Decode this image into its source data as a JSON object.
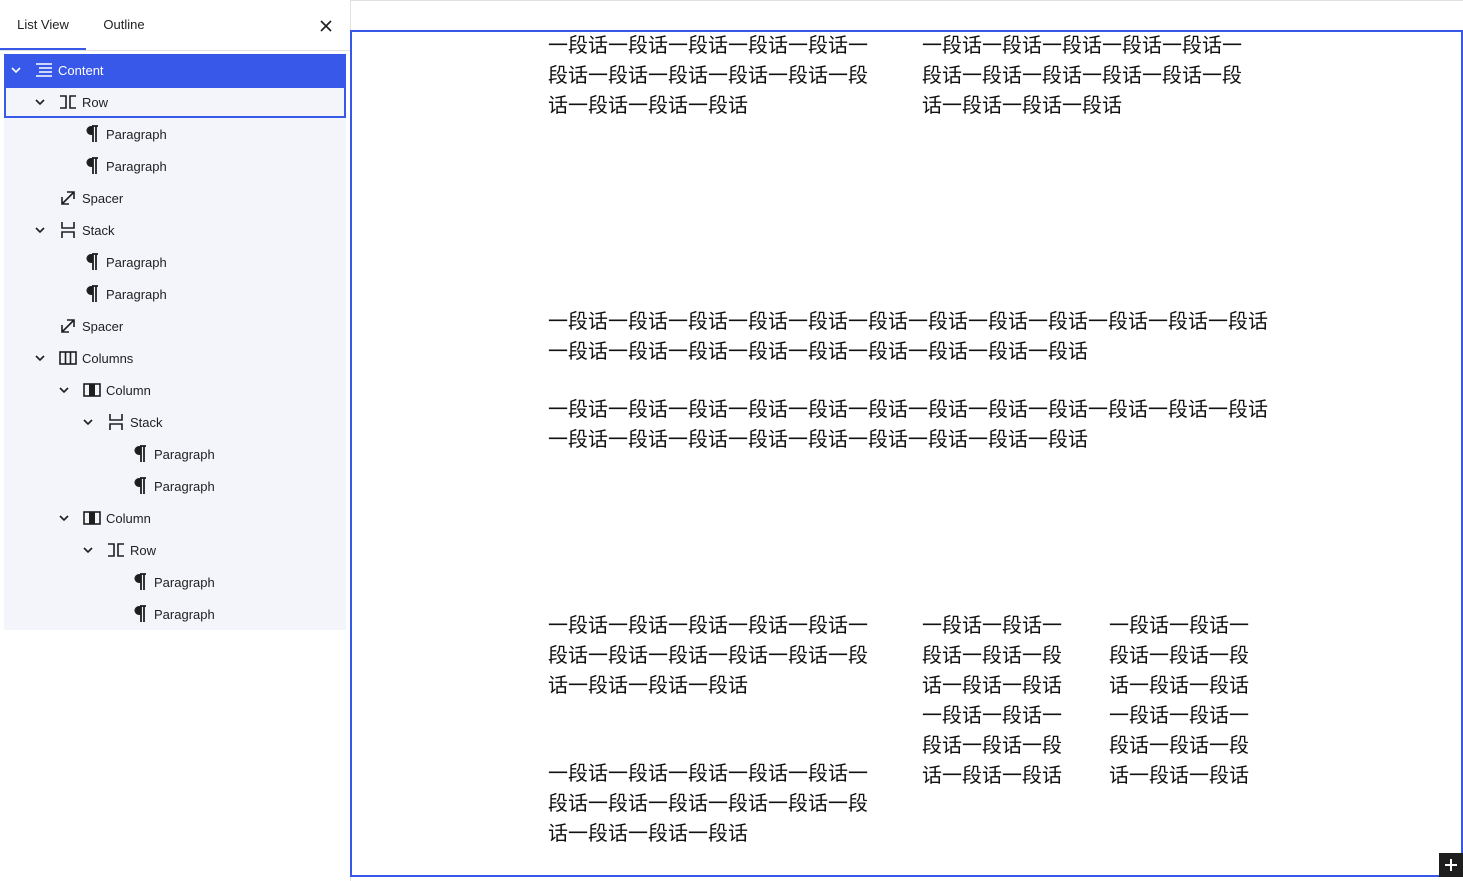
{
  "sidebar": {
    "tabs": [
      "List View",
      "Outline"
    ],
    "tree": [
      {
        "label": "Content",
        "icon": "content-icon",
        "chevron": true
      },
      {
        "label": "Row",
        "icon": "row-icon",
        "chevron": true
      },
      {
        "label": "Paragraph",
        "icon": "paragraph-icon",
        "chevron": false
      },
      {
        "label": "Paragraph",
        "icon": "paragraph-icon",
        "chevron": false
      },
      {
        "label": "Spacer",
        "icon": "spacer-icon",
        "chevron": false
      },
      {
        "label": "Stack",
        "icon": "stack-icon",
        "chevron": true
      },
      {
        "label": "Paragraph",
        "icon": "paragraph-icon",
        "chevron": false
      },
      {
        "label": "Paragraph",
        "icon": "paragraph-icon",
        "chevron": false
      },
      {
        "label": "Spacer",
        "icon": "spacer-icon",
        "chevron": false
      },
      {
        "label": "Columns",
        "icon": "columns-icon",
        "chevron": true
      },
      {
        "label": "Column",
        "icon": "column-icon",
        "chevron": true
      },
      {
        "label": "Stack",
        "icon": "stack-icon",
        "chevron": true
      },
      {
        "label": "Paragraph",
        "icon": "paragraph-icon",
        "chevron": false
      },
      {
        "label": "Paragraph",
        "icon": "paragraph-icon",
        "chevron": false
      },
      {
        "label": "Column",
        "icon": "column-icon",
        "chevron": true
      },
      {
        "label": "Row",
        "icon": "row-icon",
        "chevron": true
      },
      {
        "label": "Paragraph",
        "icon": "paragraph-icon",
        "chevron": false
      },
      {
        "label": "Paragraph",
        "icon": "paragraph-icon",
        "chevron": false
      }
    ]
  },
  "canvas": {
    "paragraphs": [
      "一段话一段话一段话一段话一段话一段话一段话一段话一段话一段话一段话一段话一段话一段话",
      "一段话一段话一段话一段话一段话一段话一段话一段话一段话一段话一段话一段话一段话一段话",
      "一段话一段话一段话一段话一段话一段话一段话一段话一段话一段话一段话一段话一段话一段话一段话一段话一段话一段话一段话一段话一段话",
      "一段话一段话一段话一段话一段话一段话一段话一段话一段话一段话一段话一段话一段话一段话一段话一段话一段话一段话一段话一段话一段话",
      "一段话一段话一段话一段话一段话一段话一段话一段话一段话一段话一段话一段话一段话一段话",
      "一段话一段话一段话一段话一段话一段话一段话一段话一段话一段话一段话一段话一段话一段话",
      "一段话一段话一段话一段话一段话一段话一段话一段话一段话一段话一段话一段话一段话一段话",
      "一段话一段话一段话一段话一段话一段话一段话一段话一段话一段话一段话一段话一段话一段话"
    ]
  },
  "colors": {
    "accent": "#3858e9",
    "tree_bg": "#f3f5fb",
    "text": "#1e1e1e"
  }
}
